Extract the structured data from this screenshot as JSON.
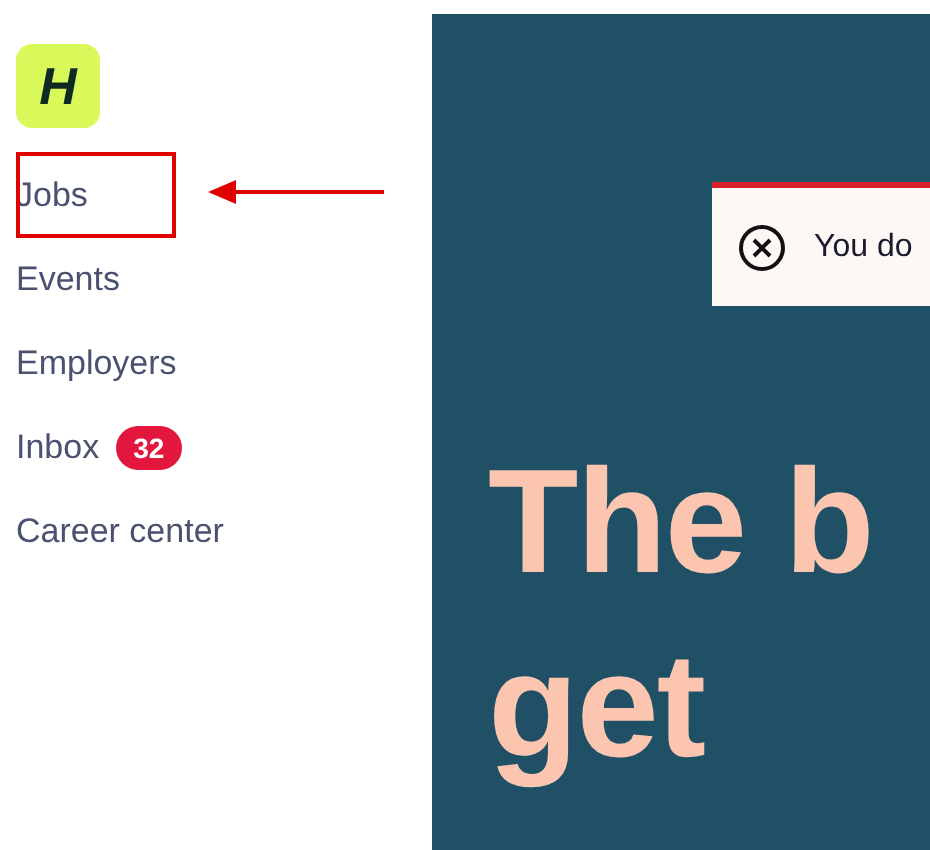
{
  "logo": {
    "letter": "H"
  },
  "nav": [
    {
      "label": "Jobs",
      "highlighted": true
    },
    {
      "label": "Events",
      "highlighted": false
    },
    {
      "label": "Employers",
      "highlighted": false
    },
    {
      "label": "Inbox",
      "highlighted": false,
      "badge": "32"
    },
    {
      "label": "Career center",
      "highlighted": false
    }
  ],
  "toast": {
    "message": "You do"
  },
  "headline": [
    "The b",
    "get"
  ]
}
